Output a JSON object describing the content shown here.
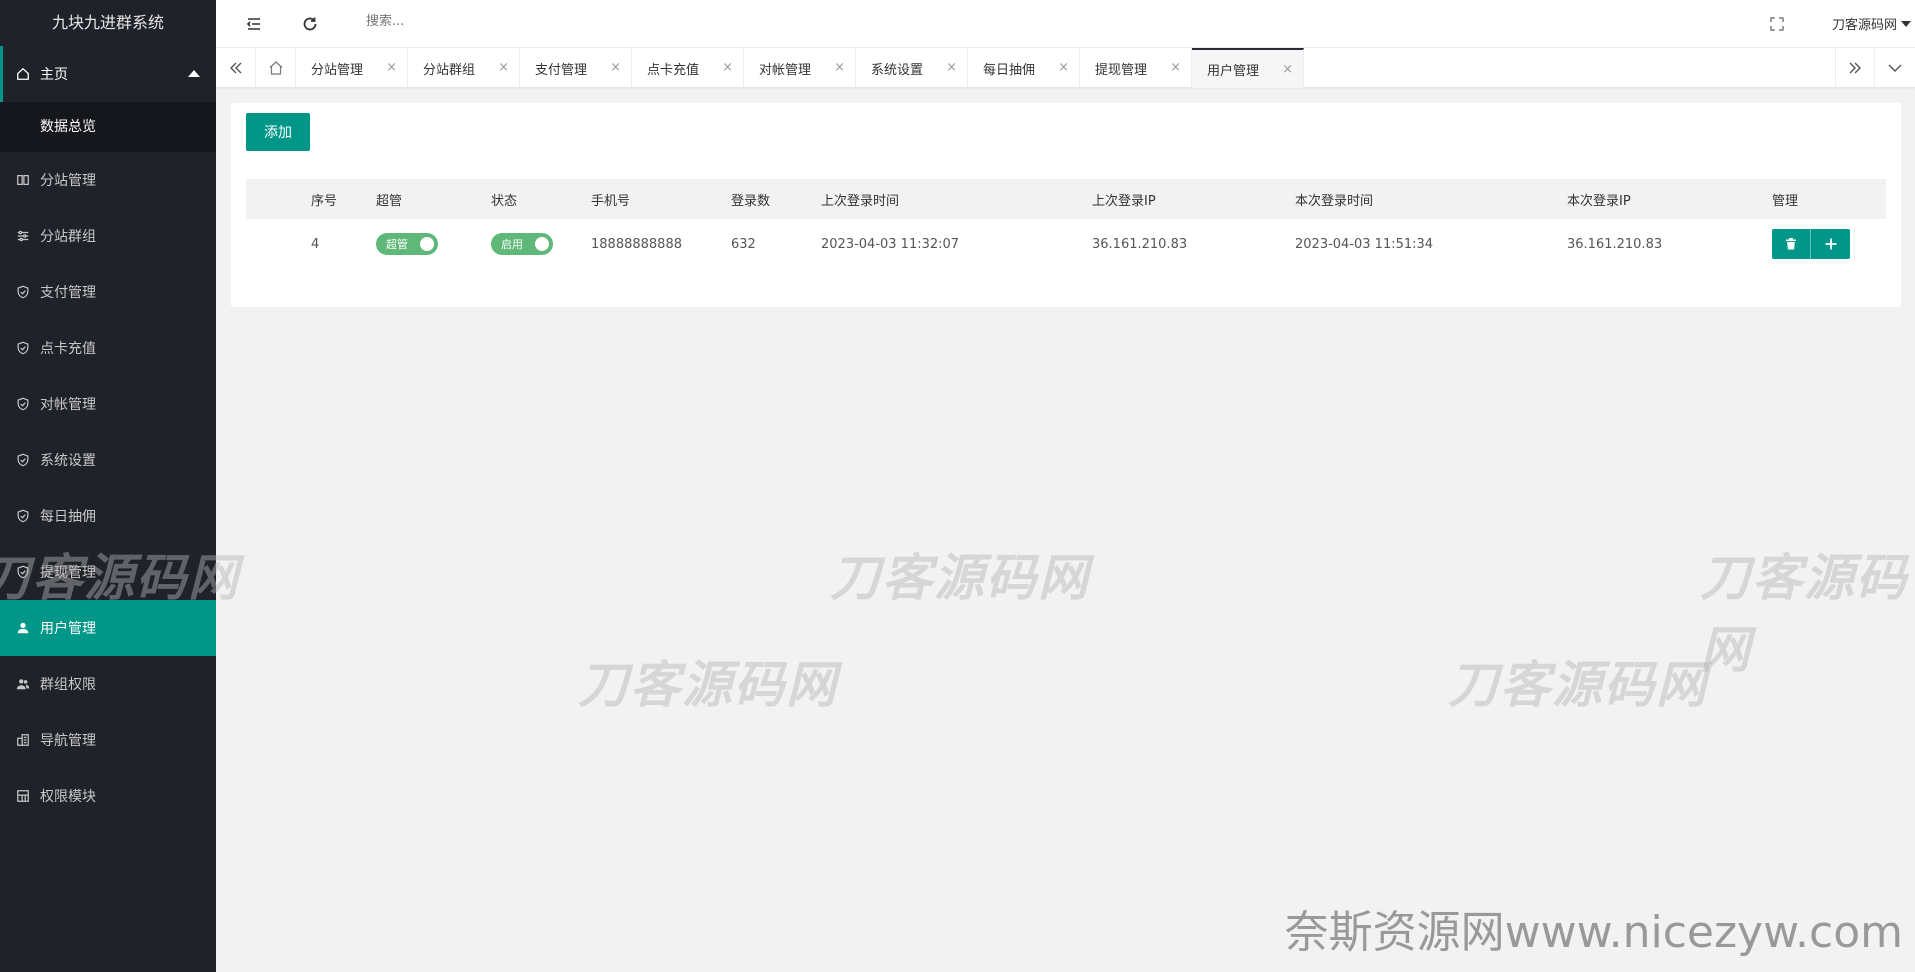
{
  "sidebar": {
    "logo": "九块九进群系统",
    "home_label": "主页",
    "sub_item": "数据总览",
    "items": [
      {
        "label": "分站管理"
      },
      {
        "label": "分站群组"
      },
      {
        "label": "支付管理"
      },
      {
        "label": "点卡充值"
      },
      {
        "label": "对帐管理"
      },
      {
        "label": "系统设置"
      },
      {
        "label": "每日抽佣"
      },
      {
        "label": "提现管理"
      },
      {
        "label": "用户管理"
      },
      {
        "label": "群组权限"
      },
      {
        "label": "导航管理"
      },
      {
        "label": "权限模块"
      }
    ],
    "active_color": "#009688"
  },
  "header": {
    "search_placeholder": "搜索...",
    "user_name": "刀客源码网"
  },
  "tabs": [
    {
      "label": "分站管理"
    },
    {
      "label": "分站群组"
    },
    {
      "label": "支付管理"
    },
    {
      "label": "点卡充值"
    },
    {
      "label": "对帐管理"
    },
    {
      "label": "系统设置"
    },
    {
      "label": "每日抽佣"
    },
    {
      "label": "提现管理"
    },
    {
      "label": "用户管理"
    }
  ],
  "tab_close": "×",
  "main": {
    "add_button": "添加",
    "columns": [
      "序号",
      "超管",
      "状态",
      "手机号",
      "登录数",
      "上次登录时间",
      "上次登录IP",
      "本次登录时间",
      "本次登录IP",
      "管理"
    ],
    "rows": [
      {
        "id": "4",
        "admin": "超管",
        "status": "启用",
        "phone": "18888888888",
        "logins": "632",
        "last_time": "2023-04-03 11:32:07",
        "last_ip": "36.161.210.83",
        "this_time": "2023-04-03 11:51:34",
        "this_ip": "36.161.210.83"
      }
    ]
  },
  "watermarks": {
    "brand": "刀客源码网",
    "site": "奈斯资源网www.nicezyw.com"
  }
}
